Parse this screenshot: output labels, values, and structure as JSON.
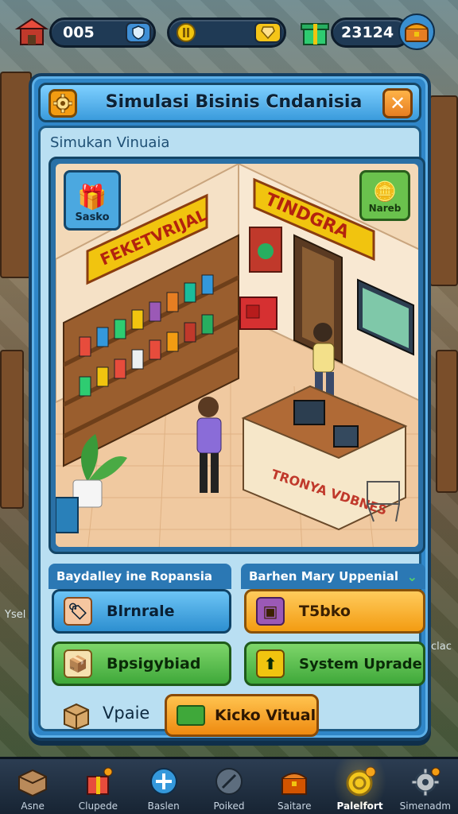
{
  "hud": {
    "left_counter": "005",
    "right_counter": "23124"
  },
  "dialog": {
    "title": "Simulasi Bisinis Cndanisia",
    "subtitle": "Simukan Vinuaia",
    "close_glyph": "✕"
  },
  "scene": {
    "left_button_label": "Sasko",
    "right_button_label": "Nareb",
    "signs": {
      "wall_left": "FEKETVRIJAL",
      "wall_right": "TINDGRA",
      "counter": "TRONYA VDBNES"
    }
  },
  "sections": {
    "left_header": "Baydalley ine Ropansia",
    "right_header": "Barhen Mary Uppenial"
  },
  "actions": {
    "blue_button": "Blrnrale",
    "orange_button": "T5bko",
    "green_left_button": "Bpsigybiad",
    "green_right_button": "System Uprade",
    "vpaie_label": "Vpaie",
    "kicko_button": "Kicko Vitual"
  },
  "background": {
    "left_sign": "Ysel",
    "right_sign": "clac"
  },
  "nav": {
    "items": [
      {
        "label": "Asne",
        "icon": "box-icon"
      },
      {
        "label": "Clupede",
        "icon": "gift-icon"
      },
      {
        "label": "Baslen",
        "icon": "plus-icon"
      },
      {
        "label": "Poiked",
        "icon": "clock-icon"
      },
      {
        "label": "Saitare",
        "icon": "chest-icon"
      },
      {
        "label": "Palelfort",
        "icon": "coin-icon",
        "active": true
      },
      {
        "label": "Simenadm",
        "icon": "gear-icon"
      }
    ]
  },
  "colors": {
    "dialog_blue": "#2f86c8",
    "accent_orange": "#f39c12",
    "accent_green": "#3fa83a"
  }
}
